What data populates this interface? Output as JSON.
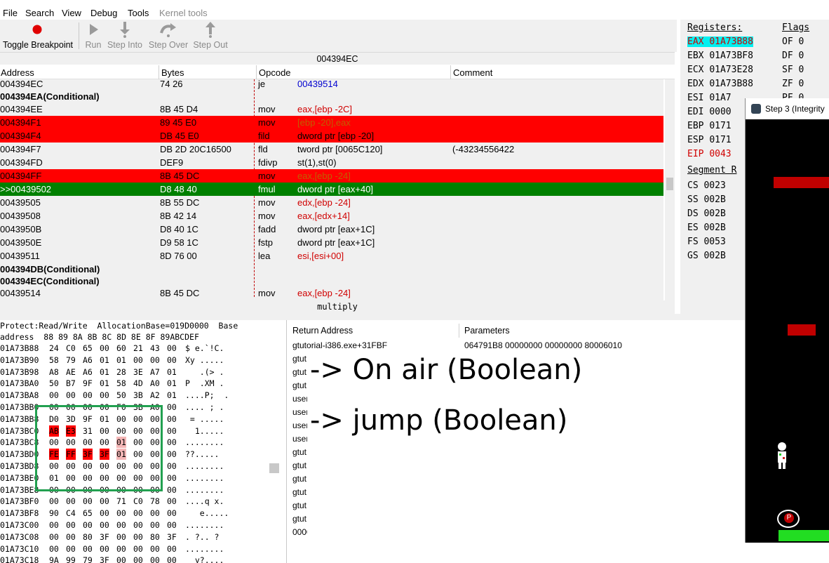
{
  "menu": [
    "File",
    "Search",
    "View",
    "Debug",
    "Tools",
    "Kernel tools"
  ],
  "toolbar": {
    "toggle_breakpoint": "Toggle Breakpoint",
    "run": "Run",
    "step_into": "Step Into",
    "step_over": "Step Over",
    "step_out": "Step Out"
  },
  "disassembler": {
    "current_address": "004394EC",
    "columns": {
      "address": "Address",
      "bytes": "Bytes",
      "opcode": "Opcode",
      "comment": "Comment"
    },
    "rows": [
      {
        "address": "004394EC",
        "bytes": "74 26",
        "opcode": "je",
        "args": "00439514",
        "comment": ""
      },
      {
        "address": "004394EA(Conditional)",
        "bytes": "",
        "opcode": "",
        "args": "",
        "comment": ""
      },
      {
        "address": "004394EE",
        "bytes": "8B 45 D4",
        "opcode": "mov",
        "args": "eax,[ebp -2C]",
        "comment": ""
      },
      {
        "address": "004394F1",
        "bytes": "89 45 E0",
        "opcode": "mov",
        "args": "[ebp -20],eax",
        "comment": ""
      },
      {
        "address": "004394F4",
        "bytes": "DB 45 E0",
        "opcode": "fild",
        "args": "dword ptr [ebp -20]",
        "comment": ""
      },
      {
        "address": "004394F7",
        "bytes": "DB 2D 20C16500",
        "opcode": "fld",
        "args": "tword ptr [0065C120]",
        "comment": "(-43234556422"
      },
      {
        "address": "004394FD",
        "bytes": "DEF9",
        "opcode": "fdivp",
        "args": "st(1),st(0)",
        "comment": ""
      },
      {
        "address": "004394FF",
        "bytes": "8B 45 DC",
        "opcode": "mov",
        "args": "eax,[ebp -24]",
        "comment": ""
      },
      {
        "address": ">>00439502",
        "bytes": "D8 48 40",
        "opcode": "fmul",
        "args": "dword ptr [eax+40]",
        "comment": ""
      },
      {
        "address": "00439505",
        "bytes": "8B 55 DC",
        "opcode": "mov",
        "args": "edx,[ebp -24]",
        "comment": ""
      },
      {
        "address": "00439508",
        "bytes": "8B 42 14",
        "opcode": "mov",
        "args": "eax,[edx+14]",
        "comment": ""
      },
      {
        "address": "0043950B",
        "bytes": "D8 40 1C",
        "opcode": "fadd",
        "args": "dword ptr [eax+1C]",
        "comment": ""
      },
      {
        "address": "0043950E",
        "bytes": "D9 58 1C",
        "opcode": "fstp",
        "args": "dword ptr [eax+1C]",
        "comment": ""
      },
      {
        "address": "00439511",
        "bytes": "8D 76 00",
        "opcode": "lea",
        "args": "esi,[esi+00]",
        "comment": ""
      },
      {
        "address": "004394DB(Conditional)",
        "bytes": "",
        "opcode": "",
        "args": "",
        "comment": ""
      },
      {
        "address": "004394EC(Conditional)",
        "bytes": "",
        "opcode": "",
        "args": "",
        "comment": ""
      },
      {
        "address": "00439514",
        "bytes": "8B 45 DC",
        "opcode": "mov",
        "args": "eax,[ebp -24]",
        "comment": ""
      }
    ],
    "function_name": "multiply"
  },
  "registers": {
    "header": "Registers:",
    "flags_header": "Flags",
    "list": [
      {
        "name": "EAX",
        "value": "01A73B88"
      },
      {
        "name": "EBX",
        "value": "01A73BF8"
      },
      {
        "name": "ECX",
        "value": "01A73E28"
      },
      {
        "name": "EDX",
        "value": "01A73B88"
      },
      {
        "name": "ESI",
        "value": "01A7"
      },
      {
        "name": "EDI",
        "value": "0000"
      },
      {
        "name": "EBP",
        "value": "0171"
      },
      {
        "name": "ESP",
        "value": "0171"
      },
      {
        "name": "EIP",
        "value": "0043"
      }
    ],
    "flags": [
      {
        "name": "OF",
        "value": "0"
      },
      {
        "name": "DF",
        "value": "0"
      },
      {
        "name": "SF",
        "value": "0"
      },
      {
        "name": "ZF",
        "value": "0"
      },
      {
        "name": "PF",
        "value": "0"
      }
    ],
    "segment_header": "Segment R",
    "segments": [
      {
        "name": "CS",
        "value": "0023"
      },
      {
        "name": "SS",
        "value": "002B"
      },
      {
        "name": "DS",
        "value": "002B"
      },
      {
        "name": "ES",
        "value": "002B"
      },
      {
        "name": "FS",
        "value": "0053"
      },
      {
        "name": "GS",
        "value": "002B"
      }
    ]
  },
  "memory": {
    "info": "Protect:Read/Write  AllocationBase=019D0000  Base",
    "header": "address  88 89 8A 8B 8C 8D 8E 8F 89ABCDEF",
    "lines": [
      {
        "addr": "01A73B88",
        "bytes": [
          "24",
          "C0",
          "65",
          "00",
          "60",
          "21",
          "43",
          "00"
        ],
        "ascii": "$ e.`!C."
      },
      {
        "addr": "01A73B90",
        "bytes": [
          "58",
          "79",
          "A6",
          "01",
          "01",
          "00",
          "00",
          "00"
        ],
        "ascii": "Xy ....."
      },
      {
        "addr": "01A73B98",
        "bytes": [
          "A8",
          "AE",
          "A6",
          "01",
          "28",
          "3E",
          "A7",
          "01"
        ],
        "ascii": "   .(> ."
      },
      {
        "addr": "01A73BA0",
        "bytes": [
          "50",
          "B7",
          "9F",
          "01",
          "58",
          "4D",
          "A0",
          "01"
        ],
        "ascii": "P  .XM ."
      },
      {
        "addr": "01A73BA8",
        "bytes": [
          "00",
          "00",
          "00",
          "00",
          "50",
          "3B",
          "A2",
          "01"
        ],
        "ascii": "....P;  ."
      },
      {
        "addr": "01A73BB0",
        "bytes": [
          "00",
          "00",
          "00",
          "00",
          "F0",
          "3B",
          "A0",
          "00"
        ],
        "ascii": ".... ; ."
      },
      {
        "addr": "01A73BB8",
        "bytes": [
          "D0",
          "3D",
          "9F",
          "01",
          "00",
          "00",
          "00",
          "00"
        ],
        "ascii": " = ....."
      },
      {
        "addr": "01A73BC0",
        "bytes": [
          "AB",
          "E3",
          "31",
          "00",
          "00",
          "00",
          "00",
          "00"
        ],
        "ascii": "  1....."
      },
      {
        "addr": "01A73BC8",
        "bytes": [
          "00",
          "00",
          "00",
          "00",
          "01",
          "00",
          "00",
          "00"
        ],
        "ascii": "........"
      },
      {
        "addr": "01A73BD0",
        "bytes": [
          "FE",
          "FF",
          "3F",
          "3F",
          "01",
          "00",
          "00",
          "00"
        ],
        "ascii": "??....."
      },
      {
        "addr": "01A73BD8",
        "bytes": [
          "00",
          "00",
          "00",
          "00",
          "00",
          "00",
          "00",
          "00"
        ],
        "ascii": "........"
      },
      {
        "addr": "01A73BE0",
        "bytes": [
          "01",
          "00",
          "00",
          "00",
          "00",
          "00",
          "00",
          "00"
        ],
        "ascii": "........"
      },
      {
        "addr": "01A73BE8",
        "bytes": [
          "00",
          "00",
          "00",
          "00",
          "00",
          "00",
          "00",
          "00"
        ],
        "ascii": "........"
      },
      {
        "addr": "01A73BF0",
        "bytes": [
          "00",
          "00",
          "00",
          "00",
          "71",
          "C0",
          "78",
          "00"
        ],
        "ascii": "....q x."
      },
      {
        "addr": "01A73BF8",
        "bytes": [
          "90",
          "C4",
          "65",
          "00",
          "00",
          "00",
          "00",
          "00"
        ],
        "ascii": "   e....."
      },
      {
        "addr": "01A73C00",
        "bytes": [
          "00",
          "00",
          "00",
          "00",
          "00",
          "00",
          "00",
          "00"
        ],
        "ascii": "........"
      },
      {
        "addr": "01A73C08",
        "bytes": [
          "00",
          "00",
          "80",
          "3F",
          "00",
          "00",
          "80",
          "3F"
        ],
        "ascii": ". ?.. ?"
      },
      {
        "addr": "01A73C10",
        "bytes": [
          "00",
          "00",
          "00",
          "00",
          "00",
          "00",
          "00",
          "00"
        ],
        "ascii": "........"
      },
      {
        "addr": "01A73C18",
        "bytes": [
          "9A",
          "99",
          "79",
          "3F",
          "00",
          "00",
          "00",
          "00"
        ],
        "ascii": "  y?...."
      },
      {
        "addr": "01A73C20",
        "bytes": [
          "00",
          "00",
          "00",
          "00",
          "00",
          "00",
          "00",
          "00"
        ],
        "ascii": "........"
      }
    ]
  },
  "stack": {
    "col_return": "Return Address",
    "col_params": "Parameters",
    "rows": [
      {
        "ret": "gtutorial-i386.exe+31FBF",
        "params": "064791B8 00000000 00000000 80006010"
      },
      {
        "ret": "gtut",
        "params": ""
      },
      {
        "ret": "gtut",
        "params": ""
      },
      {
        "ret": "gtut",
        "params": ""
      },
      {
        "ret": "user",
        "params": ""
      },
      {
        "ret": "user",
        "params": ""
      },
      {
        "ret": "user",
        "params": ""
      },
      {
        "ret": "user",
        "params": ""
      },
      {
        "ret": "gtut",
        "params": ""
      },
      {
        "ret": "gtut",
        "params": ""
      },
      {
        "ret": "gtut",
        "params": ""
      },
      {
        "ret": "gtut",
        "params": ""
      },
      {
        "ret": "gtut",
        "params": ""
      },
      {
        "ret": "gtut",
        "params": ""
      },
      {
        "ret": "0000",
        "params": ""
      }
    ]
  },
  "annotations": {
    "line1": "-> On air (Boolean)",
    "line2": "-> jump (Boolean)"
  },
  "game_window": {
    "title": "Step 3 (Integrity"
  }
}
